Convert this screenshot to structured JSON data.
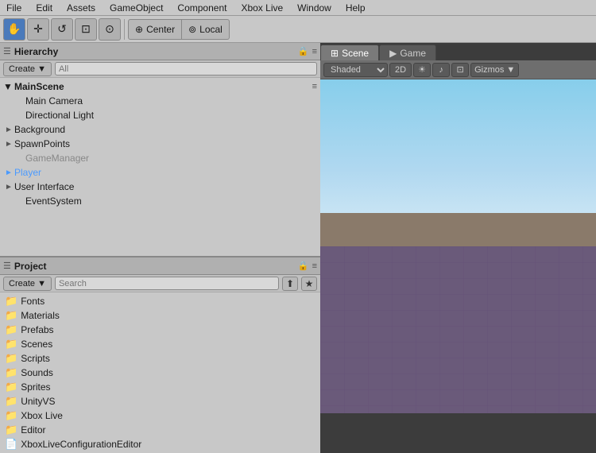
{
  "menubar": {
    "items": [
      "File",
      "Edit",
      "Assets",
      "GameObject",
      "Component",
      "Xbox Live",
      "Window",
      "Help"
    ]
  },
  "toolbar": {
    "tools": [
      {
        "id": "hand",
        "icon": "✋",
        "active": true
      },
      {
        "id": "move",
        "icon": "+",
        "active": false
      },
      {
        "id": "rotate",
        "icon": "↺",
        "active": false
      },
      {
        "id": "scale",
        "icon": "⊡",
        "active": false
      },
      {
        "id": "rect",
        "icon": "⊙",
        "active": false
      }
    ],
    "pivot_options": [
      "Center",
      "Local"
    ]
  },
  "hierarchy": {
    "title": "Hierarchy",
    "create_label": "Create ▼",
    "search_placeholder": "All",
    "scene_name": "MainScene",
    "items": [
      {
        "label": "Main Camera",
        "indent": 1,
        "arrow": "",
        "dimmed": false
      },
      {
        "label": "Directional Light",
        "indent": 1,
        "arrow": "",
        "dimmed": false
      },
      {
        "label": "Background",
        "indent": 1,
        "arrow": "►",
        "dimmed": false
      },
      {
        "label": "SpawnPoints",
        "indent": 1,
        "arrow": "►",
        "dimmed": false
      },
      {
        "label": "GameManager",
        "indent": 1,
        "arrow": "",
        "dimmed": true
      },
      {
        "label": "Player",
        "indent": 1,
        "arrow": "►",
        "dimmed": false,
        "selected": false,
        "colored": true
      },
      {
        "label": "User Interface",
        "indent": 1,
        "arrow": "►",
        "dimmed": false
      },
      {
        "label": "EventSystem",
        "indent": 1,
        "arrow": "",
        "dimmed": false
      }
    ]
  },
  "project": {
    "title": "Project",
    "create_label": "Create ▼",
    "search_placeholder": "Search",
    "folders": [
      {
        "label": "Fonts",
        "icon": "📁"
      },
      {
        "label": "Materials",
        "icon": "📁"
      },
      {
        "label": "Prefabs",
        "icon": "📁"
      },
      {
        "label": "Scenes",
        "icon": "📁"
      },
      {
        "label": "Scripts",
        "icon": "📁"
      },
      {
        "label": "Sounds",
        "icon": "📁"
      },
      {
        "label": "Sprites",
        "icon": "📁"
      },
      {
        "label": "UnityVS",
        "icon": "📁"
      },
      {
        "label": "Xbox Live",
        "icon": "📁"
      },
      {
        "label": "Editor",
        "icon": "📁"
      },
      {
        "label": "XboxLiveConfigurationEditor",
        "icon": "📄"
      }
    ]
  },
  "scene_view": {
    "tabs": [
      {
        "label": "Scene",
        "icon": "⊞",
        "active": true
      },
      {
        "label": "Game",
        "icon": "▶",
        "active": false
      }
    ],
    "shading_mode": "Shaded",
    "toolbar_buttons": [
      {
        "id": "2d",
        "label": "2D"
      },
      {
        "id": "lighting",
        "icon": "☀"
      },
      {
        "id": "audio",
        "icon": "♪"
      },
      {
        "id": "effects",
        "icon": "⊡"
      },
      {
        "id": "gizmos",
        "icon": "⊙"
      }
    ]
  }
}
